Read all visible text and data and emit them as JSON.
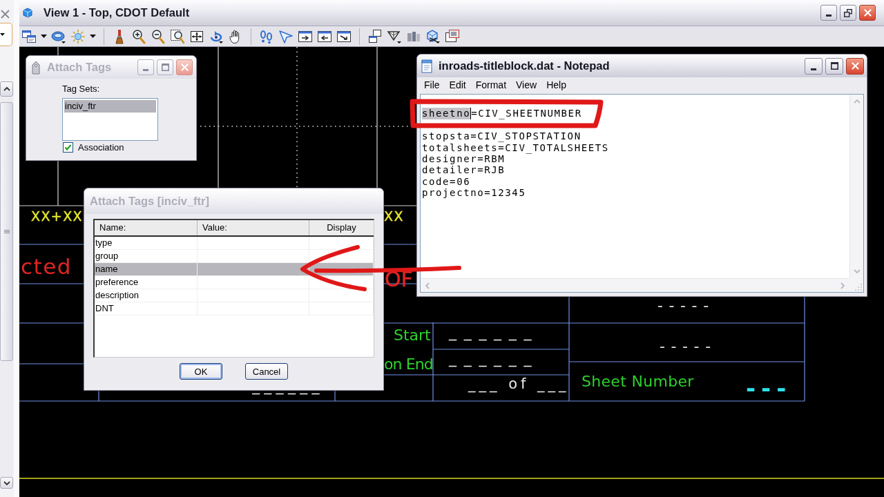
{
  "view_window": {
    "title": "View 1 - Top, CDOT Default"
  },
  "attach_tags": {
    "title": "Attach Tags",
    "active": false,
    "label": "Tag Sets:",
    "tag_sets": [
      {
        "name": "inciv_ftr",
        "selected": true
      }
    ],
    "association": {
      "label": "Association",
      "checked": true
    }
  },
  "notepad": {
    "title": "inroads-titleblock.dat - Notepad",
    "active": true,
    "menu": [
      "File",
      "Edit",
      "Format",
      "View",
      "Help"
    ],
    "lines": [
      {
        "segments": [
          {
            "text": "sheetno",
            "selected": true
          },
          {
            "text": "=CIV_SHEETNUMBER",
            "selected": false
          }
        ]
      },
      {
        "segments": [
          {
            "text": "stopsta=CIV_STOPSTATION",
            "selected": false
          }
        ]
      },
      {
        "segments": [
          {
            "text": "totalsheets=CIV_TOTALSHEETS",
            "selected": false
          }
        ]
      },
      {
        "segments": [
          {
            "text": "designer=RBM",
            "selected": false
          }
        ]
      },
      {
        "segments": [
          {
            "text": "detailer=RJB",
            "selected": false
          }
        ]
      },
      {
        "segments": [
          {
            "text": "code=06",
            "selected": false
          }
        ]
      },
      {
        "segments": [
          {
            "text": "projectno=12345",
            "selected": false
          }
        ]
      }
    ]
  },
  "tag_dialog": {
    "title": "Attach Tags [inciv_ftr]",
    "active": false,
    "columns": [
      "Name:",
      "Value:",
      "Display"
    ],
    "rows": [
      {
        "name": "type",
        "selected": false
      },
      {
        "name": "group",
        "selected": false
      },
      {
        "name": "name",
        "selected": true
      },
      {
        "name": "preference",
        "selected": false
      },
      {
        "name": "description",
        "selected": false
      },
      {
        "name": "DNT",
        "selected": false
      }
    ],
    "buttons": [
      {
        "label": "OK",
        "default": true
      },
      {
        "label": "Cancel",
        "default": false
      }
    ]
  },
  "drawing": {
    "texts": [
      {
        "text": "XX+XX",
        "color": "#e6e62e"
      },
      {
        "text": "XX",
        "color": "#e6e62e"
      },
      {
        "text": "cted",
        "color": "#e02424"
      },
      {
        "text": "OF",
        "color": "#e02424"
      },
      {
        "text": "-----",
        "color": "#e8e8e8"
      },
      {
        "text": "Start",
        "color": "#2ed12e"
      },
      {
        "text": "______",
        "color": "#e8e8e8"
      },
      {
        "text": "-----",
        "color": "#e8e8e8"
      },
      {
        "text": "on End",
        "color": "#2ed12e"
      },
      {
        "text": "______",
        "color": "#e8e8e8"
      },
      {
        "text": "Sheet Number",
        "color": "#2ed12e"
      },
      {
        "text": "---",
        "color": "#2ee0e8"
      },
      {
        "text": "______",
        "color": "#e8e8e8"
      },
      {
        "text": "___ of ___",
        "color": "#e8e8e8"
      }
    ]
  }
}
